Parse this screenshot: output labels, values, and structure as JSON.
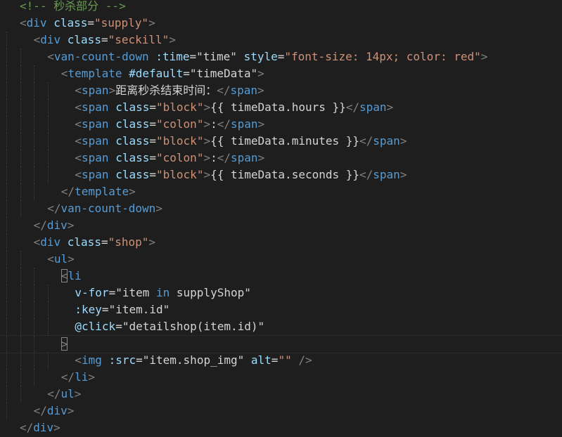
{
  "editor": {
    "colors": {
      "background": "#1e1e1e",
      "punctuation": "#808080",
      "tag": "#569cd6",
      "attribute": "#9cdcfe",
      "string": "#ce9178",
      "text": "#d4d4d4",
      "comment": "#6a9955"
    },
    "lines": [
      {
        "indent": 0,
        "tokens": [
          {
            "t": "c-cmt",
            "v": "<!-- 秒杀部分 -->"
          }
        ]
      },
      {
        "indent": 0,
        "tokens": [
          {
            "t": "c-punc",
            "v": "<"
          },
          {
            "t": "c-tag",
            "v": "div"
          },
          {
            "t": "c-text",
            "v": " "
          },
          {
            "t": "c-attr",
            "v": "class"
          },
          {
            "t": "c-text",
            "v": "="
          },
          {
            "t": "c-str",
            "v": "\"supply\""
          },
          {
            "t": "c-punc",
            "v": ">"
          }
        ]
      },
      {
        "indent": 1,
        "tokens": [
          {
            "t": "c-punc",
            "v": "<"
          },
          {
            "t": "c-tag",
            "v": "div"
          },
          {
            "t": "c-text",
            "v": " "
          },
          {
            "t": "c-attr",
            "v": "class"
          },
          {
            "t": "c-text",
            "v": "="
          },
          {
            "t": "c-str",
            "v": "\"seckill\""
          },
          {
            "t": "c-punc",
            "v": ">"
          }
        ]
      },
      {
        "indent": 2,
        "tokens": [
          {
            "t": "c-punc",
            "v": "<"
          },
          {
            "t": "c-tag",
            "v": "van-count-down"
          },
          {
            "t": "c-text",
            "v": " "
          },
          {
            "t": "c-attr",
            "v": ":time"
          },
          {
            "t": "c-text",
            "v": "="
          },
          {
            "t": "c-text",
            "v": "\"time\""
          },
          {
            "t": "c-text",
            "v": " "
          },
          {
            "t": "c-attr",
            "v": "style"
          },
          {
            "t": "c-text",
            "v": "="
          },
          {
            "t": "c-str",
            "v": "\"font-size: 14px; color: red\""
          },
          {
            "t": "c-punc",
            "v": ">"
          }
        ]
      },
      {
        "indent": 3,
        "tokens": [
          {
            "t": "c-punc",
            "v": "<"
          },
          {
            "t": "c-tag",
            "v": "template"
          },
          {
            "t": "c-text",
            "v": " "
          },
          {
            "t": "c-attr",
            "v": "#default"
          },
          {
            "t": "c-text",
            "v": "="
          },
          {
            "t": "c-text",
            "v": "\"timeData\""
          },
          {
            "t": "c-punc",
            "v": ">"
          }
        ]
      },
      {
        "indent": 4,
        "tokens": [
          {
            "t": "c-punc",
            "v": "<"
          },
          {
            "t": "c-tag",
            "v": "span"
          },
          {
            "t": "c-punc",
            "v": ">"
          },
          {
            "t": "c-text",
            "v": "距离秒杀结束时间："
          },
          {
            "t": "c-punc",
            "v": "</"
          },
          {
            "t": "c-tag",
            "v": "span"
          },
          {
            "t": "c-punc",
            "v": ">"
          }
        ]
      },
      {
        "indent": 4,
        "tokens": [
          {
            "t": "c-punc",
            "v": "<"
          },
          {
            "t": "c-tag",
            "v": "span"
          },
          {
            "t": "c-text",
            "v": " "
          },
          {
            "t": "c-attr",
            "v": "class"
          },
          {
            "t": "c-text",
            "v": "="
          },
          {
            "t": "c-str",
            "v": "\"block\""
          },
          {
            "t": "c-punc",
            "v": ">"
          },
          {
            "t": "c-text",
            "v": "{{ timeData.hours }}"
          },
          {
            "t": "c-punc",
            "v": "</"
          },
          {
            "t": "c-tag",
            "v": "span"
          },
          {
            "t": "c-punc",
            "v": ">"
          }
        ]
      },
      {
        "indent": 4,
        "tokens": [
          {
            "t": "c-punc",
            "v": "<"
          },
          {
            "t": "c-tag",
            "v": "span"
          },
          {
            "t": "c-text",
            "v": " "
          },
          {
            "t": "c-attr",
            "v": "class"
          },
          {
            "t": "c-text",
            "v": "="
          },
          {
            "t": "c-str",
            "v": "\"colon\""
          },
          {
            "t": "c-punc",
            "v": ">"
          },
          {
            "t": "c-text",
            "v": ":"
          },
          {
            "t": "c-punc",
            "v": "</"
          },
          {
            "t": "c-tag",
            "v": "span"
          },
          {
            "t": "c-punc",
            "v": ">"
          }
        ]
      },
      {
        "indent": 4,
        "tokens": [
          {
            "t": "c-punc",
            "v": "<"
          },
          {
            "t": "c-tag",
            "v": "span"
          },
          {
            "t": "c-text",
            "v": " "
          },
          {
            "t": "c-attr",
            "v": "class"
          },
          {
            "t": "c-text",
            "v": "="
          },
          {
            "t": "c-str",
            "v": "\"block\""
          },
          {
            "t": "c-punc",
            "v": ">"
          },
          {
            "t": "c-text",
            "v": "{{ timeData.minutes }}"
          },
          {
            "t": "c-punc",
            "v": "</"
          },
          {
            "t": "c-tag",
            "v": "span"
          },
          {
            "t": "c-punc",
            "v": ">"
          }
        ]
      },
      {
        "indent": 4,
        "tokens": [
          {
            "t": "c-punc",
            "v": "<"
          },
          {
            "t": "c-tag",
            "v": "span"
          },
          {
            "t": "c-text",
            "v": " "
          },
          {
            "t": "c-attr",
            "v": "class"
          },
          {
            "t": "c-text",
            "v": "="
          },
          {
            "t": "c-str",
            "v": "\"colon\""
          },
          {
            "t": "c-punc",
            "v": ">"
          },
          {
            "t": "c-text",
            "v": ":"
          },
          {
            "t": "c-punc",
            "v": "</"
          },
          {
            "t": "c-tag",
            "v": "span"
          },
          {
            "t": "c-punc",
            "v": ">"
          }
        ]
      },
      {
        "indent": 4,
        "tokens": [
          {
            "t": "c-punc",
            "v": "<"
          },
          {
            "t": "c-tag",
            "v": "span"
          },
          {
            "t": "c-text",
            "v": " "
          },
          {
            "t": "c-attr",
            "v": "class"
          },
          {
            "t": "c-text",
            "v": "="
          },
          {
            "t": "c-str",
            "v": "\"block\""
          },
          {
            "t": "c-punc",
            "v": ">"
          },
          {
            "t": "c-text",
            "v": "{{ timeData.seconds }}"
          },
          {
            "t": "c-punc",
            "v": "</"
          },
          {
            "t": "c-tag",
            "v": "span"
          },
          {
            "t": "c-punc",
            "v": ">"
          }
        ]
      },
      {
        "indent": 3,
        "tokens": [
          {
            "t": "c-punc",
            "v": "</"
          },
          {
            "t": "c-tag",
            "v": "template"
          },
          {
            "t": "c-punc",
            "v": ">"
          }
        ]
      },
      {
        "indent": 2,
        "tokens": [
          {
            "t": "c-punc",
            "v": "</"
          },
          {
            "t": "c-tag",
            "v": "van-count-down"
          },
          {
            "t": "c-punc",
            "v": ">"
          }
        ]
      },
      {
        "indent": 1,
        "tokens": [
          {
            "t": "c-punc",
            "v": "</"
          },
          {
            "t": "c-tag",
            "v": "div"
          },
          {
            "t": "c-punc",
            "v": ">"
          }
        ]
      },
      {
        "indent": 1,
        "tokens": [
          {
            "t": "c-punc",
            "v": "<"
          },
          {
            "t": "c-tag",
            "v": "div"
          },
          {
            "t": "c-text",
            "v": " "
          },
          {
            "t": "c-attr",
            "v": "class"
          },
          {
            "t": "c-text",
            "v": "="
          },
          {
            "t": "c-str",
            "v": "\"shop\""
          },
          {
            "t": "c-punc",
            "v": ">"
          }
        ]
      },
      {
        "indent": 2,
        "tokens": [
          {
            "t": "c-punc",
            "v": "<"
          },
          {
            "t": "c-tag",
            "v": "ul"
          },
          {
            "t": "c-punc",
            "v": ">"
          }
        ]
      },
      {
        "indent": 3,
        "tokens": [
          {
            "t": "c-punc bracket-hl",
            "v": "<"
          },
          {
            "t": "c-tag",
            "v": "li"
          }
        ]
      },
      {
        "indent": 4,
        "tokens": [
          {
            "t": "c-attr",
            "v": "v-for"
          },
          {
            "t": "c-text",
            "v": "="
          },
          {
            "t": "c-text",
            "v": "\"item "
          },
          {
            "t": "c-kw",
            "v": "in"
          },
          {
            "t": "c-text",
            "v": " supplyShop\""
          }
        ]
      },
      {
        "indent": 4,
        "tokens": [
          {
            "t": "c-attr",
            "v": ":key"
          },
          {
            "t": "c-text",
            "v": "="
          },
          {
            "t": "c-text",
            "v": "\"item.id\""
          }
        ]
      },
      {
        "indent": 4,
        "tokens": [
          {
            "t": "c-attr",
            "v": "@click"
          },
          {
            "t": "c-text",
            "v": "="
          },
          {
            "t": "c-text",
            "v": "\"detailshop(item.id)\""
          }
        ]
      },
      {
        "indent": 3,
        "cursor": true,
        "tokens": [
          {
            "t": "c-punc bracket-hl",
            "v": ">"
          }
        ]
      },
      {
        "indent": 4,
        "tokens": [
          {
            "t": "c-punc",
            "v": "<"
          },
          {
            "t": "c-tag",
            "v": "img"
          },
          {
            "t": "c-text",
            "v": " "
          },
          {
            "t": "c-attr",
            "v": ":src"
          },
          {
            "t": "c-text",
            "v": "="
          },
          {
            "t": "c-text",
            "v": "\"item.shop_img\""
          },
          {
            "t": "c-text",
            "v": " "
          },
          {
            "t": "c-attr",
            "v": "alt"
          },
          {
            "t": "c-text",
            "v": "="
          },
          {
            "t": "c-str",
            "v": "\"\""
          },
          {
            "t": "c-text",
            "v": " "
          },
          {
            "t": "c-punc",
            "v": "/>"
          }
        ]
      },
      {
        "indent": 3,
        "tokens": [
          {
            "t": "c-punc",
            "v": "</"
          },
          {
            "t": "c-tag",
            "v": "li"
          },
          {
            "t": "c-punc",
            "v": ">"
          }
        ]
      },
      {
        "indent": 2,
        "tokens": [
          {
            "t": "c-punc",
            "v": "</"
          },
          {
            "t": "c-tag",
            "v": "ul"
          },
          {
            "t": "c-punc",
            "v": ">"
          }
        ]
      },
      {
        "indent": 1,
        "tokens": [
          {
            "t": "c-punc",
            "v": "</"
          },
          {
            "t": "c-tag",
            "v": "div"
          },
          {
            "t": "c-punc",
            "v": ">"
          }
        ]
      },
      {
        "indent": 0,
        "tokens": [
          {
            "t": "c-punc",
            "v": "</"
          },
          {
            "t": "c-tag",
            "v": "div"
          },
          {
            "t": "c-punc",
            "v": ">"
          }
        ]
      }
    ]
  }
}
